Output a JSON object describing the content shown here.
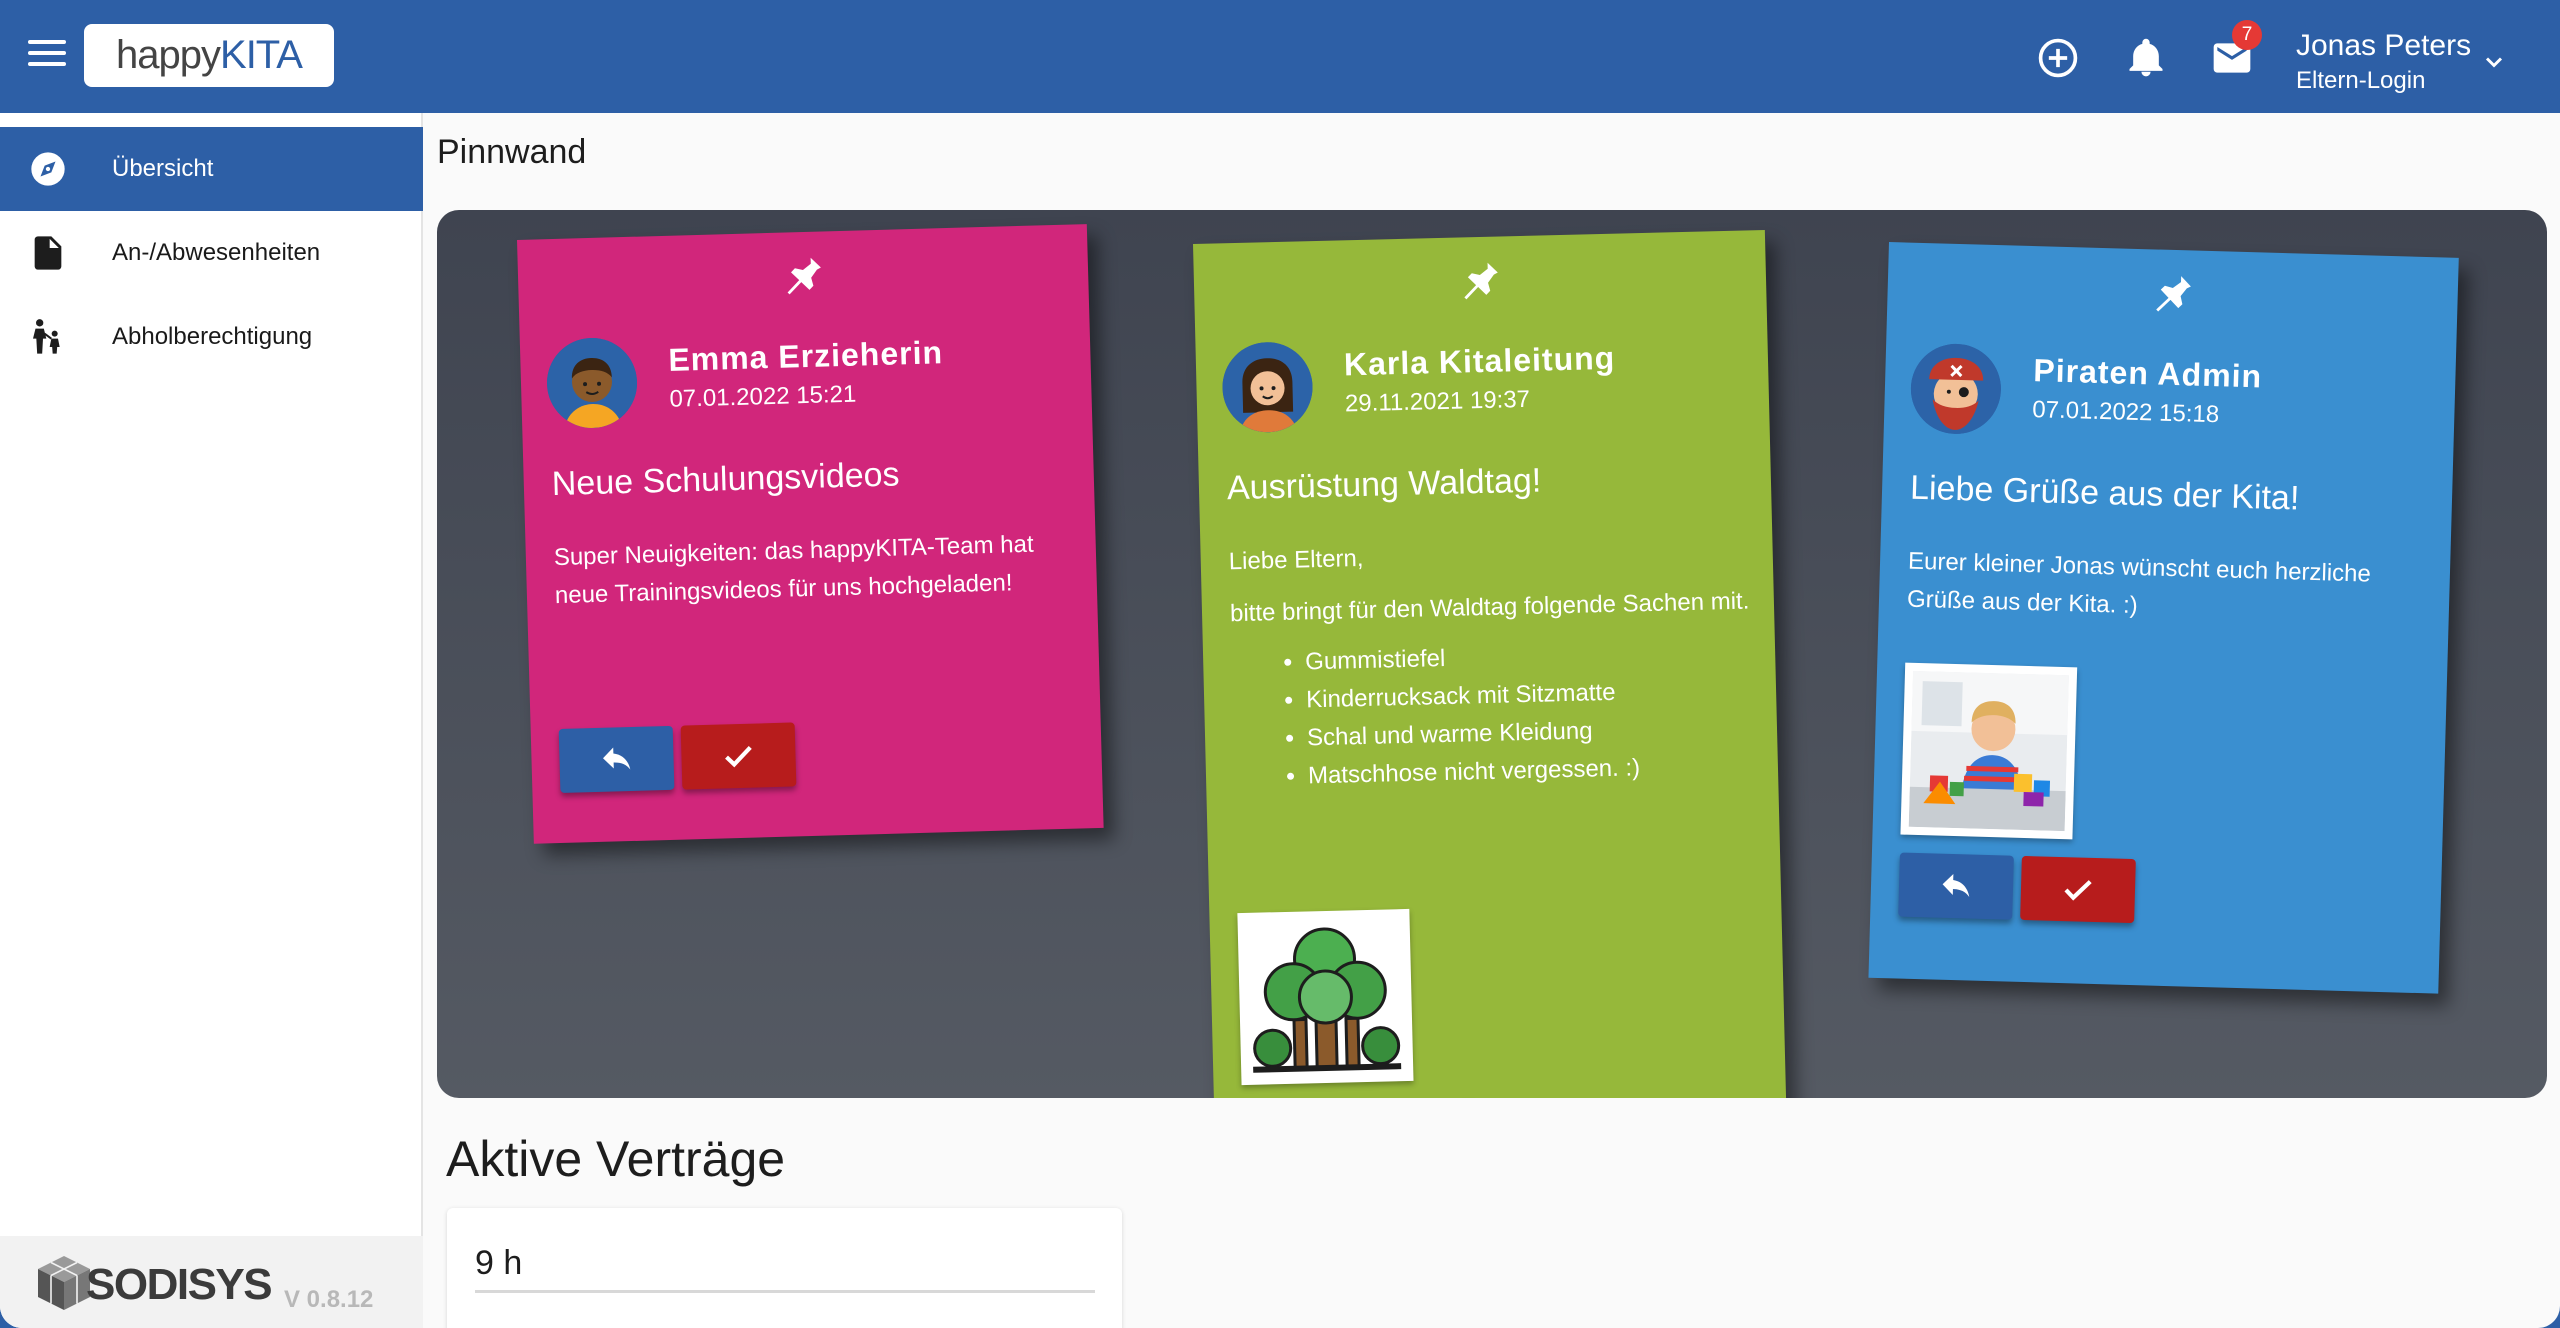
{
  "header": {
    "logo_prefix": "happy",
    "logo_suffix": "KITA",
    "notification_count": "7",
    "user_name": "Jonas Peters",
    "user_role": "Eltern-Login"
  },
  "sidebar": {
    "items": [
      {
        "label": "Übersicht",
        "icon": "compass-icon",
        "active": true
      },
      {
        "label": "An-/Abwesenheiten",
        "icon": "document-icon",
        "active": false
      },
      {
        "label": "Abholberechtigung",
        "icon": "parent-child-icon",
        "active": false
      }
    ],
    "footer_brand": "SODISYS",
    "version": "V 0.8.12"
  },
  "pinboard": {
    "title": "Pinnwand",
    "notes": [
      {
        "author": "Emma Erzieherin",
        "date": "07.01.2022 15:21",
        "title": "Neue Schulungsvideos",
        "body": "Super Neuigkeiten: das happyKITA-Team hat neue Trainingsvideos für uns hochgeladen!",
        "color": "#d1267b"
      },
      {
        "author": "Karla Kitaleitung",
        "date": "29.11.2021 19:37",
        "title": "Ausrüstung Waldtag!",
        "greeting": "Liebe Eltern,",
        "body": "bitte bringt für den Waldtag folgende Sachen mit.",
        "list": [
          "Gummistiefel",
          "Kinderrucksack mit Sitzmatte",
          "Schal und warme Kleidung",
          "Matschhose nicht vergessen. :)"
        ],
        "color": "#96b83a"
      },
      {
        "author": "Piraten Admin",
        "date": "07.01.2022 15:18",
        "title": "Liebe Grüße aus der Kita!",
        "body": "Eurer kleiner Jonas wünscht euch herzliche Grüße aus der Kita. :)",
        "color": "#3a8fd0"
      }
    ]
  },
  "contracts": {
    "title": "Aktive Verträge",
    "items": [
      {
        "hours": "9 h"
      }
    ]
  },
  "colors": {
    "primary": "#2d5fa6",
    "accent_red": "#b71c1c",
    "badge_red": "#e53935"
  }
}
